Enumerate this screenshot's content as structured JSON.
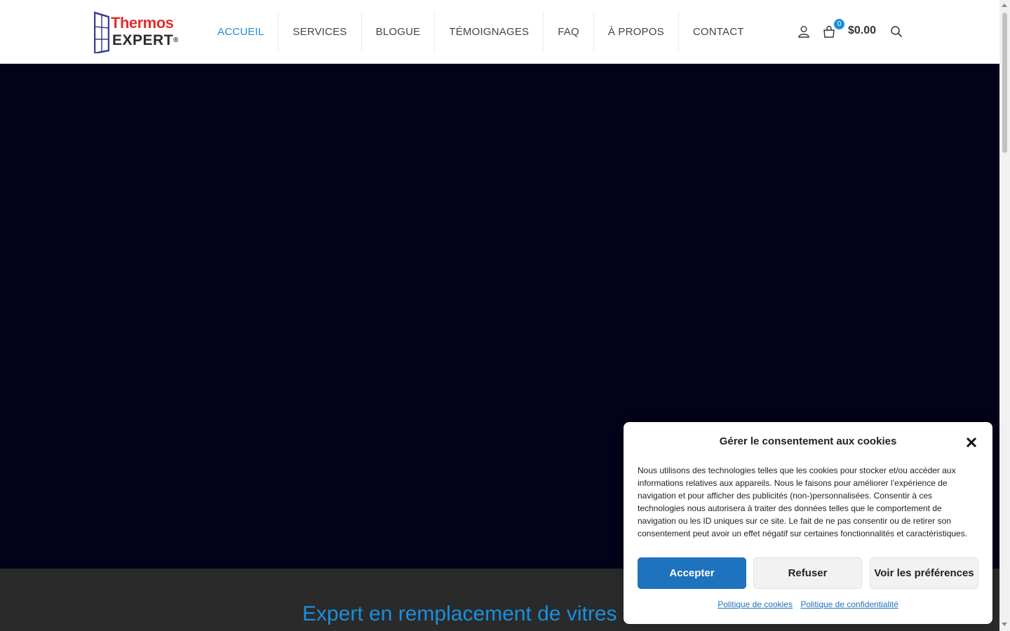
{
  "logo": {
    "line1": "Thermos",
    "line2": "EXPERT",
    "reg": "®"
  },
  "nav": {
    "items": [
      {
        "label": "ACCUEIL",
        "active": true
      },
      {
        "label": "SERVICES",
        "active": false
      },
      {
        "label": "BLOGUE",
        "active": false
      },
      {
        "label": "TÉMOIGNAGES",
        "active": false
      },
      {
        "label": "FAQ",
        "active": false
      },
      {
        "label": "À PROPOS",
        "active": false
      },
      {
        "label": "CONTACT",
        "active": false
      }
    ]
  },
  "header_icons": {
    "account": "user-icon",
    "cart": "shopping-bag-icon",
    "search": "search-icon"
  },
  "cart": {
    "count": "0",
    "total": "$0.00"
  },
  "section": {
    "title": "Expert en remplacement de vitres t"
  },
  "cookie": {
    "title": "Gérer le consentement aux cookies",
    "text": "Nous utilisons des technologies telles que les cookies pour stocker et/ou accéder aux informations relatives aux appareils. Nous le faisons pour améliorer l’expérience de navigation et pour afficher des publicités (non-)personnalisées. Consentir à ces technologies nous autorisera à traiter des données telles que le comportement de navigation ou les ID uniques sur ce site. Le fait de ne pas consentir ou de retirer son consentement peut avoir un effet négatif sur certaines fonctionnalités et caractéristiques.",
    "accept": "Accepter",
    "refuse": "Refuser",
    "preferences": "Voir les préférences",
    "link_cookies": "Politique de cookies",
    "link_privacy": "Politique de confidentialité"
  },
  "colors": {
    "accent": "#1a8fdd",
    "hero_bg": "#02021a",
    "band_bg": "#2a2a2a",
    "button_primary": "#1e73be",
    "logo_red": "#e0302a"
  }
}
